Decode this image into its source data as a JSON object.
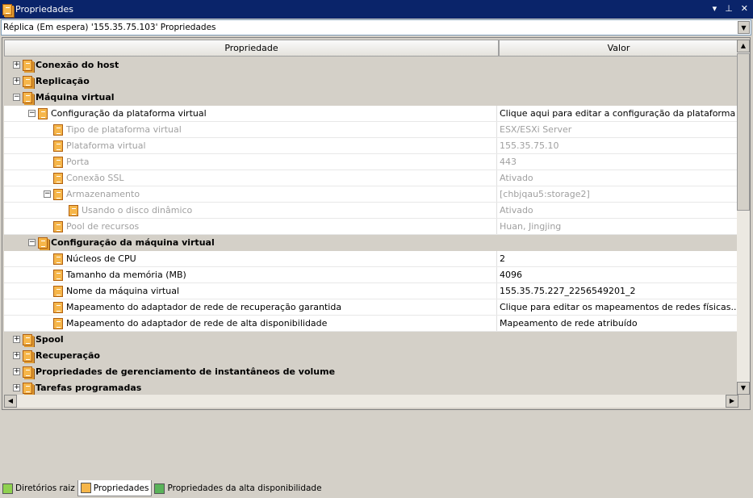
{
  "window": {
    "title": "Propriedades",
    "buttons": [
      "▾",
      "⊥",
      "✕"
    ]
  },
  "selector": {
    "value": "Réplica (Em espera)  '155.35.75.103' Propriedades"
  },
  "columns": {
    "property": "Propriedade",
    "value": "Valor"
  },
  "rows": [
    {
      "level": 0,
      "exp": "+",
      "style": "section",
      "label": "Conexão do host",
      "value": ""
    },
    {
      "level": 0,
      "exp": "+",
      "style": "section",
      "label": "Replicação",
      "value": ""
    },
    {
      "level": 0,
      "exp": "-",
      "style": "section",
      "label": "Máquina virtual",
      "value": ""
    },
    {
      "level": 1,
      "exp": "-",
      "style": "normal",
      "label": "Configuração da plataforma virtual",
      "value": "Clique aqui para editar a configuração da plataforma ."
    },
    {
      "level": 2,
      "exp": "",
      "style": "disabled",
      "label": "Tipo de plataforma virtual",
      "value": "ESX/ESXi Server"
    },
    {
      "level": 2,
      "exp": "",
      "style": "disabled",
      "label": "Plataforma virtual",
      "value": "155.35.75.10"
    },
    {
      "level": 2,
      "exp": "",
      "style": "disabled",
      "label": "Porta",
      "value": "443"
    },
    {
      "level": 2,
      "exp": "",
      "style": "disabled",
      "label": "Conexão SSL",
      "value": "Ativado"
    },
    {
      "level": 2,
      "exp": "-",
      "style": "disabled",
      "label": "Armazenamento",
      "value": "[chbjqau5:storage2]"
    },
    {
      "level": 3,
      "exp": "",
      "style": "disabled",
      "label": "Usando o disco dinâmico",
      "value": "Ativado"
    },
    {
      "level": 2,
      "exp": "",
      "style": "disabled",
      "label": "Pool de recursos",
      "value": "Huan, Jingjing"
    },
    {
      "level": 1,
      "exp": "-",
      "style": "section",
      "label": "Configuração da máquina virtual",
      "value": ""
    },
    {
      "level": 2,
      "exp": "",
      "style": "normal",
      "label": "Núcleos de CPU",
      "value": "2"
    },
    {
      "level": 2,
      "exp": "",
      "style": "normal",
      "label": "Tamanho da memória (MB)",
      "value": "4096"
    },
    {
      "level": 2,
      "exp": "",
      "style": "normal",
      "label": "Nome da máquina virtual",
      "value": "155.35.75.227_2256549201_2"
    },
    {
      "level": 2,
      "exp": "",
      "style": "normal",
      "label": "Mapeamento do adaptador de rede de recuperação garantida",
      "value": "Clique para editar os mapeamentos de redes físicas..."
    },
    {
      "level": 2,
      "exp": "",
      "style": "normal",
      "label": "Mapeamento do adaptador de rede de alta disponibilidade",
      "value": "Mapeamento de rede atribuído"
    },
    {
      "level": 0,
      "exp": "+",
      "style": "section",
      "label": "Spool",
      "value": ""
    },
    {
      "level": 0,
      "exp": "+",
      "style": "section",
      "label": "Recuperação",
      "value": ""
    },
    {
      "level": 0,
      "exp": "+",
      "style": "section",
      "label": "Propriedades de gerenciamento de instantâneos de volume",
      "value": ""
    },
    {
      "level": 0,
      "exp": "+",
      "style": "section",
      "label": "Tarefas programadas",
      "value": ""
    }
  ],
  "tabs": [
    {
      "label": "Diretórios raiz",
      "icon": "folder-icon",
      "active": false,
      "color": "#8fd14f"
    },
    {
      "label": "Propriedades",
      "icon": "properties-icon",
      "active": true,
      "color": "#f6b64a"
    },
    {
      "label": "Propriedades da alta disponibilidade",
      "icon": "ha-properties-icon",
      "active": false,
      "color": "#5ab35a"
    }
  ]
}
